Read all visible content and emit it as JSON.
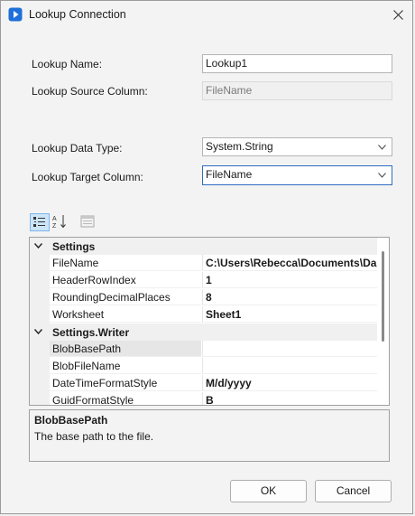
{
  "window": {
    "title": "Lookup Connection"
  },
  "form": {
    "lookup_name_label": "Lookup Name:",
    "lookup_name_value": "Lookup1",
    "source_column_label": "Lookup Source Column:",
    "source_column_value": "FileName",
    "data_type_label": "Lookup Data Type:",
    "data_type_value": "System.String",
    "target_column_label": "Lookup Target Column:",
    "target_column_value": "FileName"
  },
  "grid": {
    "categories": [
      {
        "name": "Settings",
        "properties": [
          {
            "name": "FileName",
            "value": "C:\\Users\\Rebecca\\Documents\\Da"
          },
          {
            "name": "HeaderRowIndex",
            "value": "1"
          },
          {
            "name": "RoundingDecimalPlaces",
            "value": "8"
          },
          {
            "name": "Worksheet",
            "value": "Sheet1"
          }
        ]
      },
      {
        "name": "Settings.Writer",
        "properties": [
          {
            "name": "BlobBasePath",
            "value": ""
          },
          {
            "name": "BlobFileName",
            "value": ""
          },
          {
            "name": "DateTimeFormatStyle",
            "value": "M/d/yyyy"
          },
          {
            "name": "GuidFormatStyle",
            "value": "B"
          }
        ]
      }
    ],
    "selected_property": "BlobBasePath"
  },
  "description": {
    "title": "BlobBasePath",
    "text": "The base path to the file."
  },
  "buttons": {
    "ok": "OK",
    "cancel": "Cancel"
  },
  "colors": {
    "accent": "#2f6cc0",
    "icon_blue": "#1e6fd9"
  }
}
